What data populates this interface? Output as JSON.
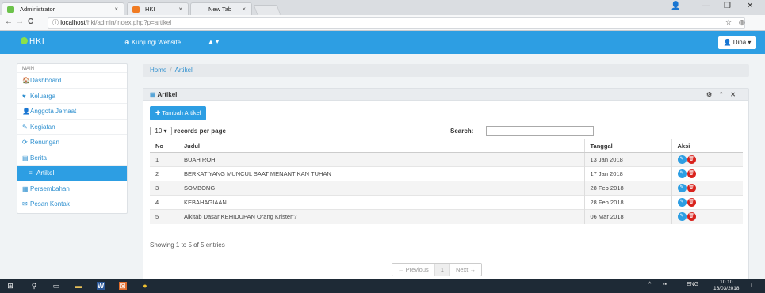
{
  "browser": {
    "tabs": [
      {
        "label": "Administrator",
        "close": "×"
      },
      {
        "label": "HKI",
        "close": "×"
      },
      {
        "label": "New Tab",
        "close": "×"
      }
    ],
    "window_controls": {
      "profile": "👤",
      "minimize": "—",
      "maximize": "❐",
      "close": "✕"
    },
    "nav": {
      "back": "←",
      "forward": "→",
      "reload": "C",
      "info": "ⓘ"
    },
    "url_host": "localhost",
    "url_path": "/hki/admin/index.php?p=artikel",
    "star": "☆",
    "ext": "◍",
    "menu": "⋮"
  },
  "navbar": {
    "brand": "HKI",
    "visit_label": "Kunjungi Website",
    "bell_label": "▲ ▾",
    "user_label": "Dina ▾"
  },
  "sidebar": {
    "section": "MAIN",
    "items": [
      {
        "icon": "🏠",
        "label": "Dashboard"
      },
      {
        "icon": "♥",
        "label": "Keluarga"
      },
      {
        "icon": "👤",
        "label": "Anggota Jemaat"
      },
      {
        "icon": "✎",
        "label": "Kegiatan"
      },
      {
        "icon": "⟳",
        "label": "Renungan"
      },
      {
        "icon": "▤",
        "label": "Berita"
      },
      {
        "icon": "≡",
        "label": "Artikel"
      },
      {
        "icon": "▦",
        "label": "Persembahan"
      },
      {
        "icon": "✉",
        "label": "Pesan Kontak"
      }
    ]
  },
  "breadcrumb": {
    "home": "Home",
    "sep": "/",
    "current": "Artikel"
  },
  "panel": {
    "title": "Artikel",
    "tools": "⚙ ⌃ ✕",
    "add_label": "Tambah Artikel",
    "records_value": "10",
    "records_label": "records per page",
    "search_label": "Search:",
    "columns": {
      "no": "No",
      "judul": "Judul",
      "tanggal": "Tanggal",
      "aksi": "Aksi"
    },
    "rows": [
      {
        "no": "1",
        "judul": "BUAH ROH",
        "tanggal": "13 Jan 2018"
      },
      {
        "no": "2",
        "judul": "BERKAT YANG MUNCUL SAAT MENANTIKAN TUHAN",
        "tanggal": "17 Jan 2018"
      },
      {
        "no": "3",
        "judul": "SOMBONG",
        "tanggal": "28 Feb 2018"
      },
      {
        "no": "4",
        "judul": "KEBAHAGIAAN",
        "tanggal": "28 Feb 2018"
      },
      {
        "no": "5",
        "judul": "Alkitab Dasar KEHIDUPAN Orang Kristen?",
        "tanggal": "06 Mar 2018"
      }
    ],
    "edit_icon": "✎",
    "delete_icon": "🗑",
    "showing": "Showing 1 to 5 of 5 entries",
    "pager": {
      "prev": "← Previous",
      "page": "1",
      "next": "Next →"
    }
  },
  "taskbar": {
    "start": "⊞",
    "search": "⚲",
    "taskview": "▭",
    "explorer": "▬",
    "word": "W",
    "app": "⊠",
    "chrome": "●",
    "tray_arrow": "^",
    "tray_icons": "▪▪",
    "lang": "ENG",
    "time": "10.10",
    "date": "16/03/2018",
    "notif": "▢"
  }
}
